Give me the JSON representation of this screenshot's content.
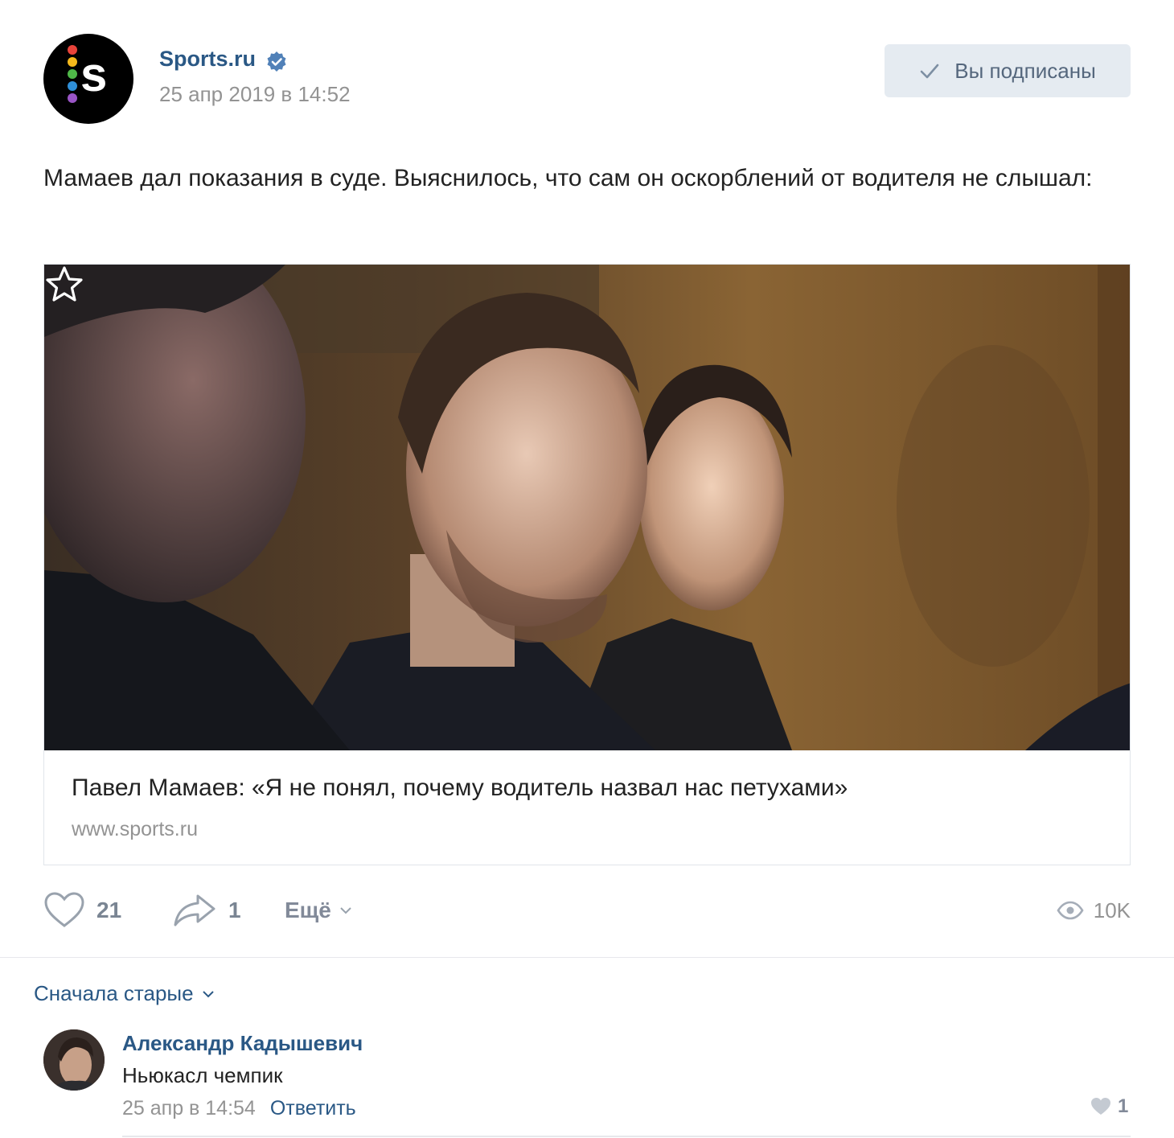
{
  "post": {
    "author": "Sports.ru",
    "verified": true,
    "date": "25 апр 2019 в 14:52",
    "subscribe_label": "Вы подписаны",
    "text": "Мамаев дал показания в суде. Выяснилось, что сам он оскорблений от водителя не слышал:",
    "avatar_letter": "s",
    "avatar_dot_colors": [
      "#e8433a",
      "#f5b91c",
      "#4fb848",
      "#2f8fd8",
      "#9a55c6"
    ]
  },
  "link_card": {
    "title": "Павел Мамаев: «Я не понял, почему водитель назвал нас петухами»",
    "domain": "www.sports.ru",
    "fave_icon": "star-icon"
  },
  "actions": {
    "likes": "21",
    "shares": "1",
    "more_label": "Ещё",
    "views": "10K"
  },
  "comments": {
    "sort_label": "Сначала старые",
    "items": [
      {
        "author": "Александр Кадышевич",
        "text": "Ньюкасл чемпик",
        "date": "25 апр в 14:54",
        "reply_label": "Ответить",
        "likes": "1"
      }
    ]
  },
  "colors": {
    "link_blue": "#2a5885",
    "button_bg": "#e5ebf1",
    "meta_gray": "#939393"
  }
}
